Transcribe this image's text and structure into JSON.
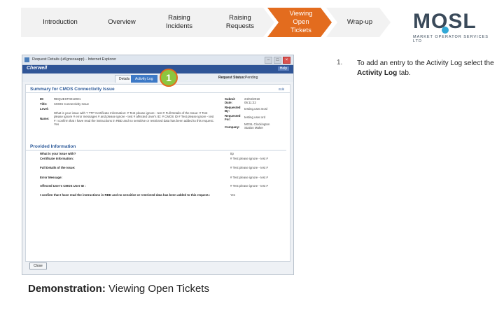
{
  "nav": {
    "steps": [
      {
        "label": "Introduction"
      },
      {
        "label": "Overview"
      },
      {
        "label": "Raising Incidents"
      },
      {
        "label": "Raising Requests"
      },
      {
        "label": "Viewing Open Tickets"
      },
      {
        "label": "Wrap-up"
      }
    ],
    "active_color": "#e36c1e"
  },
  "logo": {
    "word": "MOSL",
    "tagline": "MARKET OPERATOR SERVICES LTD",
    "dot_color": "#31a8d6"
  },
  "window": {
    "title": "Request Details (uKgnscaapp) - Internet Explorer",
    "brand": "Cherwell",
    "help": "Help",
    "tabs": [
      "Details",
      "Activity Log"
    ],
    "status_label": "Request Status:",
    "status_value": "Pending",
    "summary_title": "Summary for CMOS Connectivity Issue",
    "edit": "Edit",
    "fields": {
      "id_label": "ID:",
      "id_value": "REQUEST0012001",
      "title_label": "Title:",
      "title_value": "CMOS Connectivity Issue",
      "level_label": "Level:",
      "name_label": "Name:",
      "name_value": "What is your issue with ? TTP Certificate Information: # Test please ignore - test # Full Details of the Issue: # Test please ignore # error messages # and please ignore - test # affected User's ID: # CMOS ID # Test please ignore - test # I confirm that I have read the instructions in RBD and no sensitive or restricted data has been added to this request.: Yes",
      "submit_label": "Submit Date:",
      "submit_value": "24/04/2018 06:11:22",
      "requested_by_label": "Requested By:",
      "requested_by_value": "testing.user.mosl",
      "requested_for_label": "Requested For:",
      "requested_for_value": "testing user.ord",
      "company_label": "Company:",
      "company_value": "MOSL Clockington Station Maker"
    },
    "provided_title": "Provided Information",
    "provided": [
      {
        "q": "What is your issue with?",
        "a": "ttp"
      },
      {
        "q": "Certificate Information:",
        "a": "# Test please ignore - test #"
      },
      {
        "q": "Full Details of the Issue:",
        "a": "# Test please ignore - test #"
      },
      {
        "q": "Error Message:",
        "a": "# Test please ignore - test #"
      },
      {
        "q": "Affected User's CMOS User ID :",
        "a": "# Test please ignore - test #"
      },
      {
        "q": "I confirm that I have read the instructions in RBD and no sensitive or restricted data has been added to this request.:",
        "a": "Yes"
      }
    ],
    "close": "Close"
  },
  "callout_number": "1",
  "caption": {
    "bold": "Demonstration:",
    "rest": " Viewing Open Tickets"
  },
  "instruction": {
    "number": "1.",
    "prefix": "To add an entry to the Activity Log select the ",
    "bold": "Activity Log",
    "suffix": " tab."
  }
}
